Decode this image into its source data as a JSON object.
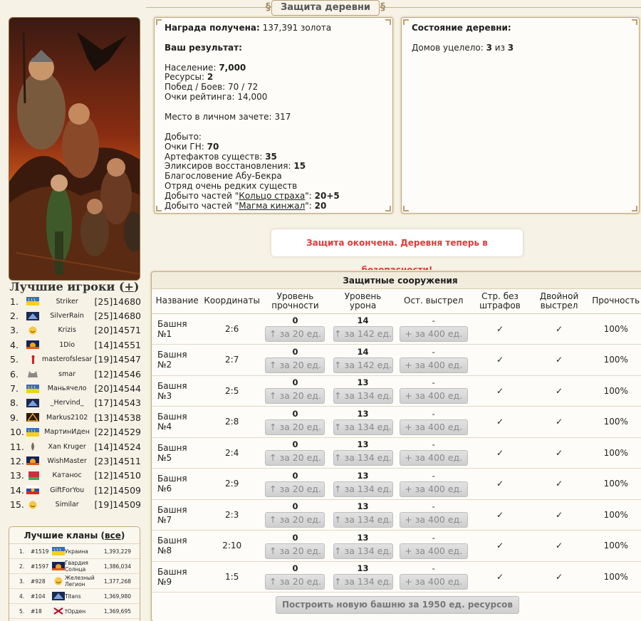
{
  "page_title": "Защита деревни",
  "left": {
    "players_title": "Лучшие игроки",
    "players_toggle": "+",
    "players": [
      {
        "rank": "1.",
        "name": "Striker",
        "level": "[25]",
        "score": "14680",
        "flag": "ukraine"
      },
      {
        "rank": "2.",
        "name": "SilverRain",
        "level": "[25]",
        "score": "14680",
        "flag": "guild-dragon"
      },
      {
        "rank": "3.",
        "name": "Krizis",
        "level": "[20]",
        "score": "14571",
        "flag": "smiley"
      },
      {
        "rank": "4.",
        "name": "1Dio",
        "level": "[14]",
        "score": "14551",
        "flag": "sunset"
      },
      {
        "rank": "5.",
        "name": "masterofslesar",
        "level": "[19]",
        "score": "14547",
        "flag": "red-figure"
      },
      {
        "rank": "6.",
        "name": "smar",
        "level": "[12]",
        "score": "14546",
        "flag": "wolf"
      },
      {
        "rank": "7.",
        "name": "Маньячело",
        "level": "[20]",
        "score": "14544",
        "flag": "ukraine"
      },
      {
        "rank": "8.",
        "name": "_Hervind_",
        "level": "[17]",
        "score": "14543",
        "flag": "guild-dragon"
      },
      {
        "rank": "9.",
        "name": "Markus2102",
        "level": "[13]",
        "score": "14538",
        "flag": "triangle"
      },
      {
        "rank": "10.",
        "name": "МартинИден",
        "level": "[22]",
        "score": "14529",
        "flag": "ukraine"
      },
      {
        "rank": "11.",
        "name": "Xan Kruger",
        "level": "[14]",
        "score": "14524",
        "flag": "feather"
      },
      {
        "rank": "12.",
        "name": "WishMaster",
        "level": "[23]",
        "score": "14511",
        "flag": "sunset"
      },
      {
        "rank": "13.",
        "name": "Катанос",
        "level": "[12]",
        "score": "14510",
        "flag": "belarus"
      },
      {
        "rank": "14.",
        "name": "GiftForYou",
        "level": "[12]",
        "score": "14509",
        "flag": "russia-crest"
      },
      {
        "rank": "15.",
        "name": "Similar",
        "level": "[19]",
        "score": "14509",
        "flag": "smiley"
      }
    ],
    "clans_title": "Лучшие кланы",
    "clans_all": "все",
    "clans": [
      {
        "rank": "1.",
        "id": "#1519",
        "name": "Украина",
        "score": "1,393,229",
        "flag": "ukraine"
      },
      {
        "rank": "2.",
        "id": "#1597",
        "name": "Гвардия Солнца",
        "score": "1,386,034",
        "flag": "sunset"
      },
      {
        "rank": "3.",
        "id": "#928",
        "name": "Железный Легион",
        "score": "1,377,268",
        "flag": "smiley"
      },
      {
        "rank": "4.",
        "id": "#104",
        "name": "Titans",
        "score": "1,369,980",
        "flag": "guild-dragon"
      },
      {
        "rank": "5.",
        "id": "#18",
        "name": "†Орден",
        "score": "1,369,695",
        "flag": "cross"
      }
    ]
  },
  "result": {
    "reward_label": "Награда получена:",
    "reward_value": "137,391 золота",
    "your_result": "Ваш результат:",
    "population_label": "Население:",
    "population_value": "7,000",
    "resources_label": "Ресурсы:",
    "resources_value": "2",
    "wins_label": "Побед / Боев:",
    "wins_value": "70 / 72",
    "rating_label": "Очки рейтинга:",
    "rating_value": "14,000",
    "place_label": "Место в личном зачете:",
    "place_value": "317",
    "loot_label": "Добыто:",
    "gn_label": "Очки ГН:",
    "gn_value": "70",
    "artifacts_label": "Артефактов существ:",
    "artifacts_value": "35",
    "elixirs_label": "Эликсиров восстановления:",
    "elixirs_value": "15",
    "blessing": "Благословение Абу-Бекра",
    "rare_squad": "Отряд очень редких существ",
    "ring_prefix": "Добыто частей \"",
    "ring_link": "Кольцо страха",
    "ring_suffix": "\":",
    "ring_value": "20+5",
    "dagger_prefix": "Добыто частей \"",
    "dagger_link": "Магма кинжал",
    "dagger_suffix": "\":",
    "dagger_value": "20"
  },
  "state": {
    "title": "Состояние деревни:",
    "houses_label": "Домов уцелело:",
    "houses_survived": "3",
    "houses_of": "из",
    "houses_total": "3"
  },
  "notice": "Защита окончена. Деревня теперь в безопасности!",
  "towers": {
    "title": "Защитные сооружения",
    "columns": {
      "name": "Название",
      "coords": "Координаты",
      "durability_lvl": "Уровень прочности",
      "damage_lvl": "Уровень урона",
      "shots_left": "Ост. выстрел",
      "no_penalty": "Стр. без штрафов",
      "double_shot": "Двойной выстрел",
      "durability": "Прочность"
    },
    "rows": [
      {
        "name": "Башня №1",
        "coords": "2:6",
        "dur_lvl": "0",
        "dur_btn": "↑ за 20 ед.",
        "dmg_lvl": "14",
        "dmg_btn": "↑ за 142 ед.",
        "shots": "-",
        "shots_btn": "+ за 400 ед.",
        "nopen": "✓",
        "double": "✓",
        "dur": "100%"
      },
      {
        "name": "Башня №2",
        "coords": "2:7",
        "dur_lvl": "0",
        "dur_btn": "↑ за 20 ед.",
        "dmg_lvl": "14",
        "dmg_btn": "↑ за 142 ед.",
        "shots": "-",
        "shots_btn": "+ за 400 ед.",
        "nopen": "✓",
        "double": "✓",
        "dur": "100%"
      },
      {
        "name": "Башня №3",
        "coords": "2:5",
        "dur_lvl": "0",
        "dur_btn": "↑ за 20 ед.",
        "dmg_lvl": "13",
        "dmg_btn": "↑ за 134 ед.",
        "shots": "-",
        "shots_btn": "+ за 400 ед.",
        "nopen": "✓",
        "double": "✓",
        "dur": "100%"
      },
      {
        "name": "Башня №4",
        "coords": "2:8",
        "dur_lvl": "0",
        "dur_btn": "↑ за 20 ед.",
        "dmg_lvl": "13",
        "dmg_btn": "↑ за 134 ед.",
        "shots": "-",
        "shots_btn": "+ за 400 ед.",
        "nopen": "✓",
        "double": "✓",
        "dur": "100%"
      },
      {
        "name": "Башня №5",
        "coords": "2:4",
        "dur_lvl": "0",
        "dur_btn": "↑ за 20 ед.",
        "dmg_lvl": "13",
        "dmg_btn": "↑ за 134 ед.",
        "shots": "-",
        "shots_btn": "+ за 400 ед.",
        "nopen": "✓",
        "double": "✓",
        "dur": "100%"
      },
      {
        "name": "Башня №6",
        "coords": "2:9",
        "dur_lvl": "0",
        "dur_btn": "↑ за 20 ед.",
        "dmg_lvl": "13",
        "dmg_btn": "↑ за 134 ед.",
        "shots": "-",
        "shots_btn": "+ за 400 ед.",
        "nopen": "✓",
        "double": "✓",
        "dur": "100%"
      },
      {
        "name": "Башня №7",
        "coords": "2:3",
        "dur_lvl": "0",
        "dur_btn": "↑ за 20 ед.",
        "dmg_lvl": "13",
        "dmg_btn": "↑ за 134 ед.",
        "shots": "-",
        "shots_btn": "+ за 400 ед.",
        "nopen": "✓",
        "double": "✓",
        "dur": "100%"
      },
      {
        "name": "Башня №8",
        "coords": "2:10",
        "dur_lvl": "0",
        "dur_btn": "↑ за 20 ед.",
        "dmg_lvl": "13",
        "dmg_btn": "↑ за 134 ед.",
        "shots": "-",
        "shots_btn": "+ за 400 ед.",
        "nopen": "✓",
        "double": "✓",
        "dur": "100%"
      },
      {
        "name": "Башня №9",
        "coords": "1:5",
        "dur_lvl": "0",
        "dur_btn": "↑ за 20 ед.",
        "dmg_lvl": "13",
        "dmg_btn": "↑ за 134 ед.",
        "shots": "-",
        "shots_btn": "+ за 400 ед.",
        "nopen": "✓",
        "double": "✓",
        "dur": "100%"
      }
    ],
    "build_button": "Построить новую башню за 1950 ед. ресурсов"
  },
  "colors": {
    "notice_text": "#e03a3a",
    "panel_border": "#bca77e",
    "background": "#f6f2e6"
  }
}
